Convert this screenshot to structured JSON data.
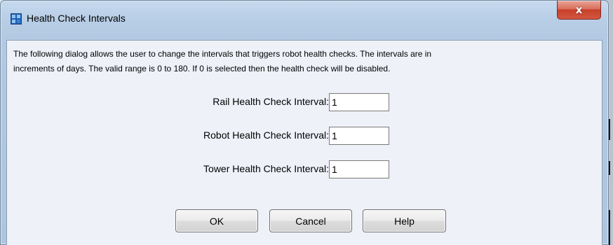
{
  "window": {
    "title": "Health Check Intervals",
    "close_glyph": "x"
  },
  "dialog": {
    "description_line1": "The following dialog allows the user to change the intervals that triggers robot health checks. The intervals are in",
    "description_line2": "increments of days. The valid range is 0 to 180. If 0 is selected then the health check will be disabled.",
    "fields": [
      {
        "label": "Rail Health Check Interval:",
        "value": "1"
      },
      {
        "label": "Robot Health Check Interval:",
        "value": "1"
      },
      {
        "label": "Tower Health Check Interval:",
        "value": "1"
      }
    ]
  },
  "buttons": {
    "ok": "OK",
    "cancel": "Cancel",
    "help": "Help"
  },
  "icons": {
    "app": "app-window-icon",
    "close": "close-icon"
  },
  "colors": {
    "close_button": "#c7402a",
    "client_background": "#eef1f8"
  }
}
